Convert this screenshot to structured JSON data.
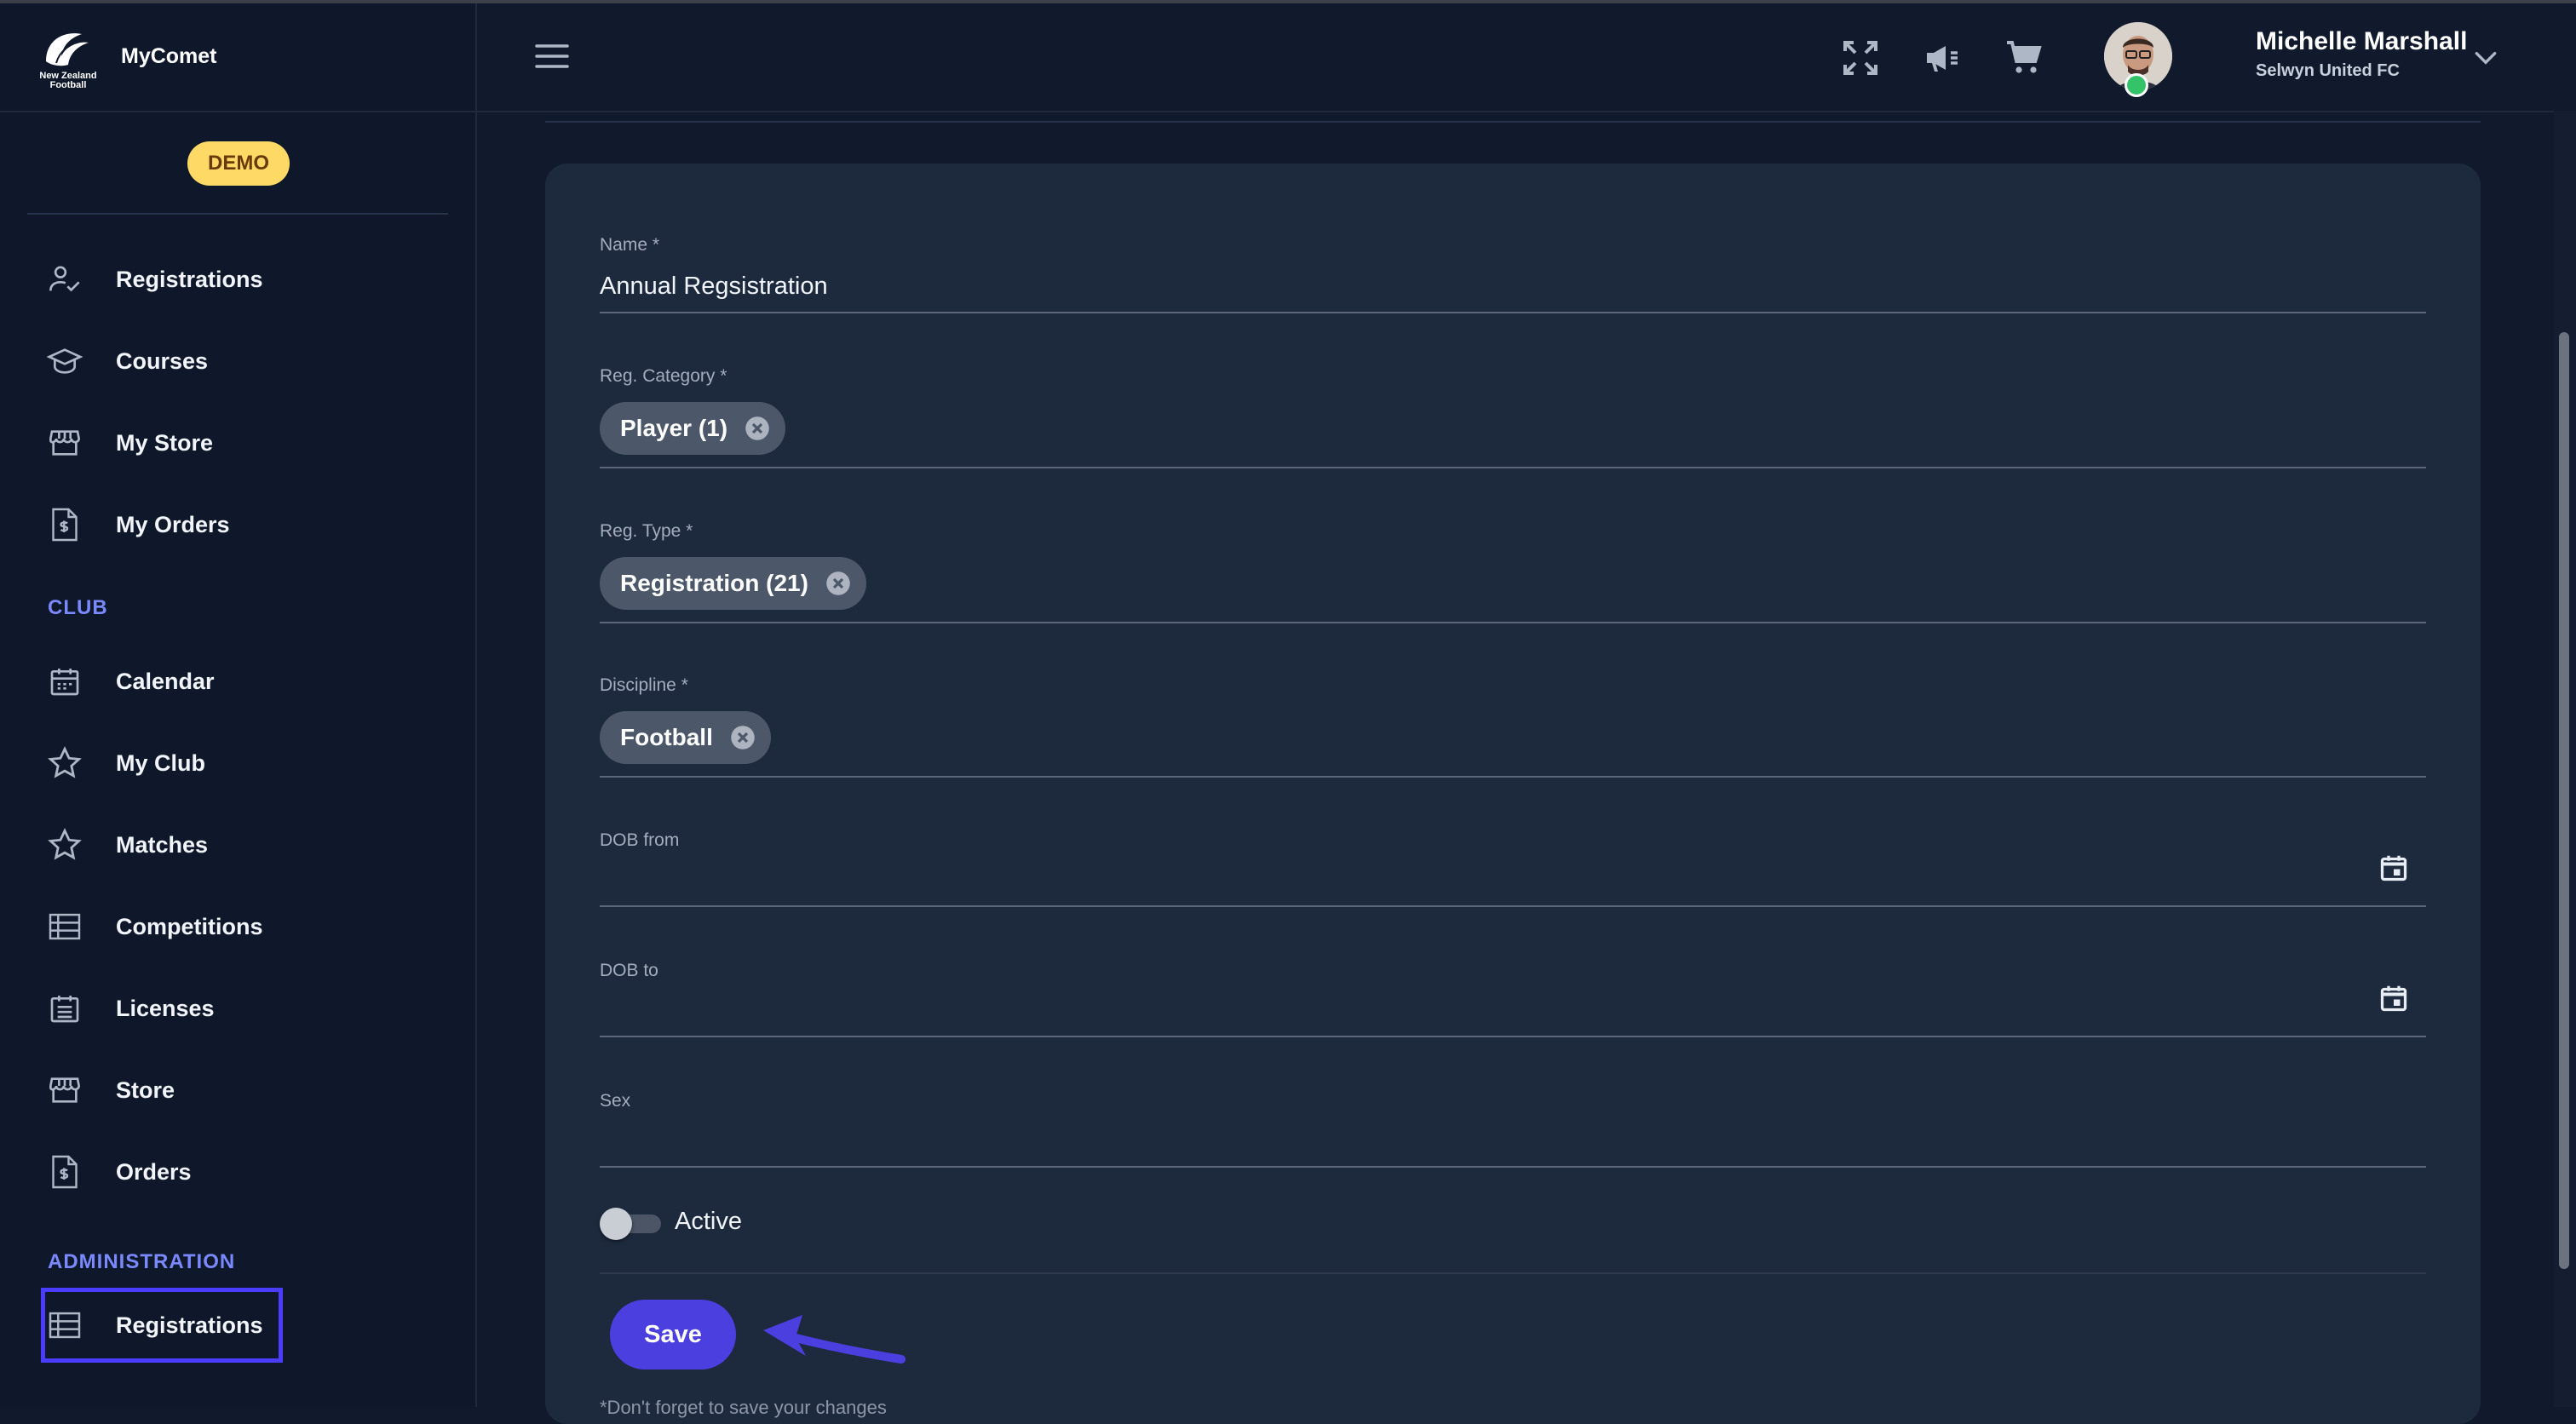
{
  "app": {
    "name": "MyComet",
    "logo_text": "New Zealand Football",
    "badge": "DEMO"
  },
  "sidebar": {
    "items": [
      {
        "label": "Registrations",
        "icon": "person-check-icon"
      },
      {
        "label": "Courses",
        "icon": "graduation-cap-icon"
      },
      {
        "label": "My Store",
        "icon": "storefront-icon"
      },
      {
        "label": "My Orders",
        "icon": "invoice-icon"
      }
    ],
    "club_title": "CLUB",
    "club_items": [
      {
        "label": "Calendar",
        "icon": "calendar-icon"
      },
      {
        "label": "My Club",
        "icon": "star-icon"
      },
      {
        "label": "Matches",
        "icon": "star-icon"
      },
      {
        "label": "Competitions",
        "icon": "list-icon"
      },
      {
        "label": "Licenses",
        "icon": "calendar-list-icon"
      },
      {
        "label": "Store",
        "icon": "storefront-icon"
      },
      {
        "label": "Orders",
        "icon": "invoice-icon"
      }
    ],
    "admin_title": "ADMINISTRATION",
    "admin_items": [
      {
        "label": "Registrations",
        "icon": "list-icon",
        "selected": true
      }
    ]
  },
  "header": {
    "user_name": "Michelle Marshall",
    "user_club": "Selwyn United FC",
    "icons": [
      "menu-icon",
      "fullscreen-icon",
      "megaphone-icon",
      "cart-icon",
      "chevron-down-icon"
    ]
  },
  "form": {
    "name_label": "Name *",
    "name_value": "Annual Regsistration",
    "category_label": "Reg. Category *",
    "category_chip": "Player (1)",
    "type_label": "Reg. Type *",
    "type_chip": "Registration (21)",
    "discipline_label": "Discipline *",
    "discipline_chip": "Football",
    "dob_from_label": "DOB from",
    "dob_to_label": "DOB to",
    "sex_label": "Sex",
    "active_label": "Active",
    "active_on": false,
    "save_label": "Save",
    "note": "*Don't forget to save your changes"
  },
  "colors": {
    "accent": "#4b3fe0",
    "demo_badge": "#ffd966",
    "section_title": "#7b89ff",
    "status_online": "#35c36a"
  }
}
